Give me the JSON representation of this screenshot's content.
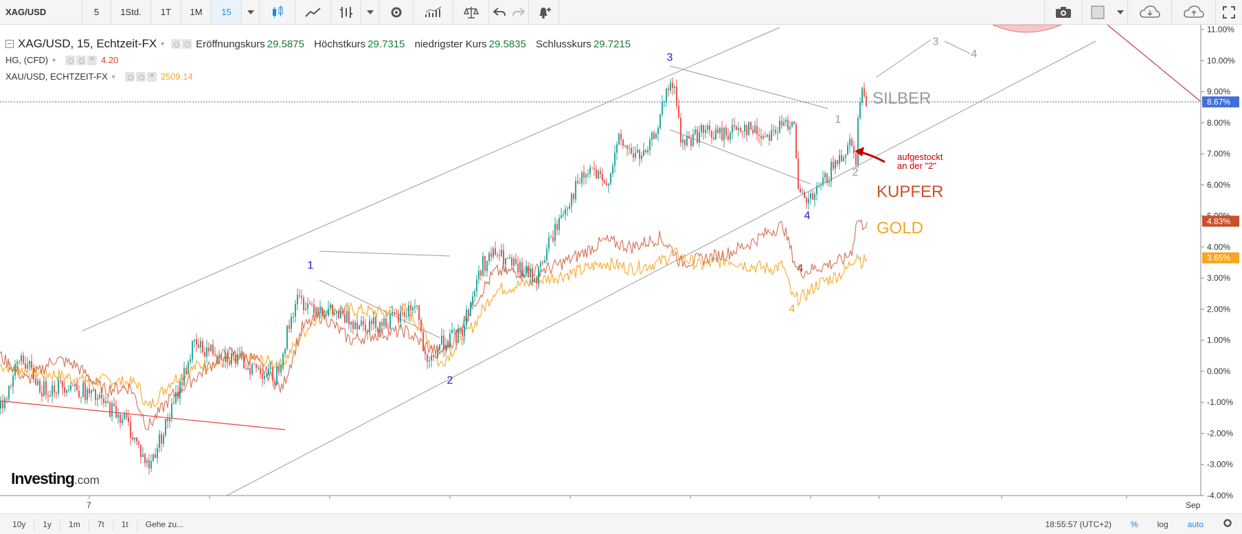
{
  "toolbar": {
    "symbol": "XAG/USD",
    "intervals": [
      "5",
      "1Std.",
      "1T",
      "1M",
      "15"
    ],
    "active_interval": "15"
  },
  "legend": {
    "main_name": "XAG/USD, 15, Echtzeit-FX",
    "open_label": "Eröffnungskurs",
    "open_value": "29.5875",
    "high_label": "Höchstkurs",
    "high_value": "29.7315",
    "low_label": "niedrigster Kurs",
    "low_value": "29.5835",
    "close_label": "Schlusskurs",
    "close_value": "29.7215",
    "hg_name": "HG, (CFD)",
    "hg_value": "4.20",
    "xau_name": "XAU/USD, ECHTZEIT-FX",
    "xau_value": "2509.14"
  },
  "annotations": {
    "silber": "SILBER",
    "kupfer": "KUPFER",
    "gold": "GOLD",
    "note_line1": "aufgestockt",
    "note_line2": "an der \"2\""
  },
  "chart_data": {
    "type": "line",
    "y_unit": "%",
    "ylim": [
      -4,
      11
    ],
    "y_ticks": [
      "11.00%",
      "10.00%",
      "9.00%",
      "8.00%",
      "7.00%",
      "6.00%",
      "5.00%",
      "4.00%",
      "3.00%",
      "2.00%",
      "1.00%",
      "0.00%",
      "-1.00%",
      "-2.00%",
      "-3.00%",
      "-4.00%"
    ],
    "x_ticks": [
      "7",
      "Sep"
    ],
    "series": [
      {
        "name": "SILBER",
        "color": "#26a69a",
        "last_value": "8.67%",
        "points": [
          [
            0,
            -1.2
          ],
          [
            30,
            0.5
          ],
          [
            60,
            -0.6
          ],
          [
            100,
            -0.4
          ],
          [
            140,
            -0.9
          ],
          [
            180,
            -1.5
          ],
          [
            215,
            -3.1
          ],
          [
            250,
            -1.2
          ],
          [
            280,
            0.8
          ],
          [
            320,
            0.6
          ],
          [
            360,
            0.2
          ],
          [
            400,
            -0.2
          ],
          [
            430,
            2.3
          ],
          [
            460,
            2.1
          ],
          [
            500,
            1.7
          ],
          [
            540,
            1.5
          ],
          [
            580,
            1.7
          ],
          [
            605,
            2.2
          ],
          [
            620,
            0.0
          ],
          [
            640,
            0.9
          ],
          [
            670,
            1.2
          ],
          [
            700,
            3.4
          ],
          [
            720,
            3.8
          ],
          [
            750,
            3.3
          ],
          [
            780,
            3.0
          ],
          [
            800,
            4.2
          ],
          [
            820,
            5.2
          ],
          [
            840,
            6.0
          ],
          [
            860,
            6.5
          ],
          [
            880,
            5.9
          ],
          [
            900,
            7.4
          ],
          [
            920,
            7.0
          ],
          [
            940,
            6.9
          ],
          [
            960,
            8.2
          ],
          [
            975,
            9.3
          ],
          [
            985,
            8.7
          ],
          [
            990,
            7.3
          ],
          [
            1020,
            7.7
          ],
          [
            1050,
            7.6
          ],
          [
            1080,
            7.9
          ],
          [
            1110,
            7.6
          ],
          [
            1140,
            7.9
          ],
          [
            1155,
            8.2
          ],
          [
            1160,
            5.7
          ],
          [
            1175,
            5.4
          ],
          [
            1190,
            5.8
          ],
          [
            1210,
            6.5
          ],
          [
            1225,
            7.0
          ],
          [
            1240,
            7.5
          ],
          [
            1245,
            6.8
          ],
          [
            1250,
            8.8
          ],
          [
            1258,
            8.9
          ],
          [
            1262,
            8.67
          ]
        ]
      },
      {
        "name": "KUPFER",
        "color": "#d06a4e",
        "last_value": "4.83%",
        "points": [
          [
            0,
            0.5
          ],
          [
            40,
            -0.3
          ],
          [
            80,
            0.4
          ],
          [
            110,
            0.2
          ],
          [
            150,
            -0.6
          ],
          [
            190,
            -0.5
          ],
          [
            215,
            -1.8
          ],
          [
            250,
            -0.8
          ],
          [
            290,
            -0.1
          ],
          [
            330,
            0.6
          ],
          [
            370,
            0.4
          ],
          [
            410,
            -0.6
          ],
          [
            440,
            1.4
          ],
          [
            470,
            1.8
          ],
          [
            510,
            1.0
          ],
          [
            550,
            1.2
          ],
          [
            590,
            1.3
          ],
          [
            620,
            0.8
          ],
          [
            640,
            0.6
          ],
          [
            660,
            1.0
          ],
          [
            690,
            2.2
          ],
          [
            720,
            3.2
          ],
          [
            760,
            3.2
          ],
          [
            800,
            3.3
          ],
          [
            840,
            3.7
          ],
          [
            880,
            4.2
          ],
          [
            920,
            4.0
          ],
          [
            960,
            4.3
          ],
          [
            980,
            3.9
          ],
          [
            990,
            3.5
          ],
          [
            1020,
            3.6
          ],
          [
            1060,
            3.8
          ],
          [
            1090,
            4.1
          ],
          [
            1120,
            4.5
          ],
          [
            1140,
            4.7
          ],
          [
            1160,
            3.3
          ],
          [
            1170,
            3.2
          ],
          [
            1200,
            3.4
          ],
          [
            1230,
            3.6
          ],
          [
            1240,
            3.9
          ],
          [
            1248,
            4.9
          ],
          [
            1255,
            4.7
          ],
          [
            1262,
            4.83
          ]
        ]
      },
      {
        "name": "GOLD",
        "color": "#f5a623",
        "last_value": "3.65%",
        "points": [
          [
            0,
            0.2
          ],
          [
            40,
            0.0
          ],
          [
            80,
            -0.1
          ],
          [
            120,
            -0.3
          ],
          [
            160,
            -0.3
          ],
          [
            200,
            -0.4
          ],
          [
            215,
            -1.2
          ],
          [
            250,
            -0.3
          ],
          [
            290,
            0.2
          ],
          [
            330,
            0.3
          ],
          [
            370,
            0.4
          ],
          [
            410,
            0.2
          ],
          [
            440,
            1.2
          ],
          [
            470,
            2.0
          ],
          [
            510,
            2.0
          ],
          [
            550,
            1.9
          ],
          [
            590,
            2.0
          ],
          [
            620,
            1.2
          ],
          [
            640,
            0.2
          ],
          [
            660,
            0.7
          ],
          [
            690,
            1.5
          ],
          [
            720,
            2.6
          ],
          [
            760,
            2.8
          ],
          [
            800,
            3.0
          ],
          [
            840,
            3.2
          ],
          [
            880,
            3.5
          ],
          [
            920,
            3.3
          ],
          [
            960,
            3.5
          ],
          [
            980,
            3.8
          ],
          [
            1020,
            3.4
          ],
          [
            1060,
            3.6
          ],
          [
            1090,
            3.4
          ],
          [
            1120,
            3.3
          ],
          [
            1140,
            3.4
          ],
          [
            1155,
            2.3
          ],
          [
            1170,
            2.4
          ],
          [
            1190,
            2.8
          ],
          [
            1210,
            3.0
          ],
          [
            1230,
            3.2
          ],
          [
            1248,
            3.8
          ],
          [
            1255,
            3.5
          ],
          [
            1262,
            3.65
          ]
        ]
      }
    ],
    "wave_labels": [
      {
        "text": "1",
        "x": 452,
        "y": 3.3,
        "color": "#1a1adb"
      },
      {
        "text": "2",
        "x": 655,
        "y": -0.4,
        "color": "#1a1adb"
      },
      {
        "text": "3",
        "x": 975,
        "y": 10.0,
        "color": "#1a1adb"
      },
      {
        "text": "4",
        "x": 1175,
        "y": 4.9,
        "color": "#1a1adb"
      },
      {
        "text": "1",
        "x": 1220,
        "y": 8.0,
        "color": "#999999"
      },
      {
        "text": "2",
        "x": 1245,
        "y": 6.3,
        "color": "#999999"
      },
      {
        "text": "3",
        "x": 1362,
        "y": 10.5,
        "color": "#999999"
      },
      {
        "text": "4",
        "x": 1418,
        "y": 10.1,
        "color": "#999999"
      },
      {
        "text": "4",
        "x": 1165,
        "y": 3.2,
        "color": "#c0392b"
      },
      {
        "text": "4",
        "x": 1153,
        "y": 1.9,
        "color": "#f5a623"
      }
    ]
  },
  "bottombar": {
    "ranges": [
      "10y",
      "1y",
      "1m",
      "7t",
      "1t"
    ],
    "goto": "Gehe zu...",
    "time": "18:55:57 (UTC+2)",
    "percent": "%",
    "log": "log",
    "auto": "auto"
  },
  "logo": {
    "main": "Investing",
    "suffix": ".com"
  }
}
